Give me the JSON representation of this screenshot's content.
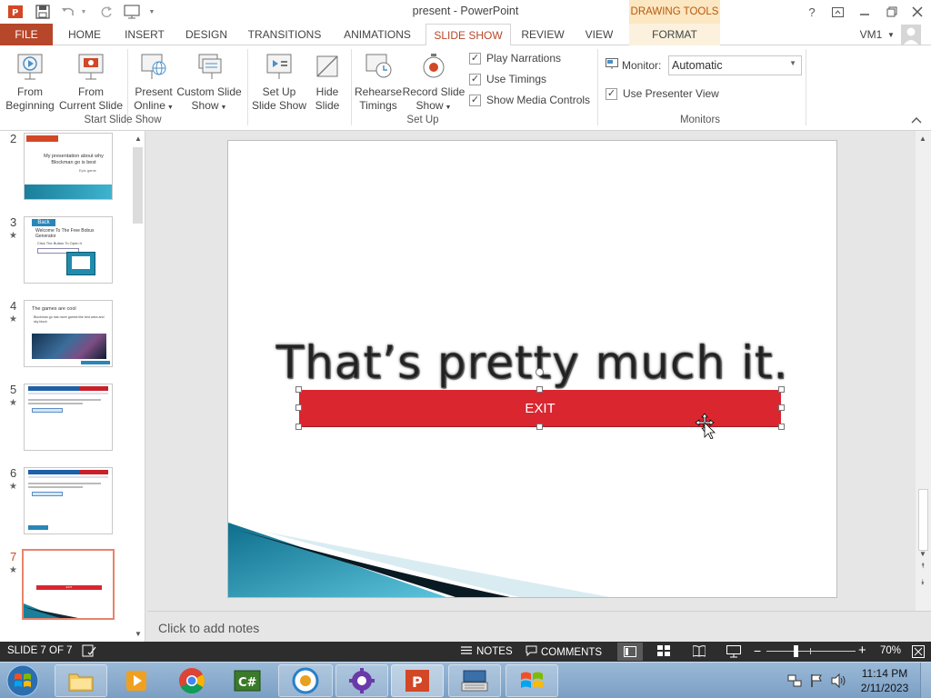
{
  "app": {
    "title": "present - PowerPoint",
    "contextual_tab_group": "DRAWING TOOLS",
    "user": "VM1",
    "help": "?"
  },
  "tabs": [
    {
      "label": "FILE"
    },
    {
      "label": "HOME"
    },
    {
      "label": "INSERT"
    },
    {
      "label": "DESIGN"
    },
    {
      "label": "TRANSITIONS"
    },
    {
      "label": "ANIMATIONS"
    },
    {
      "label": "SLIDE SHOW",
      "active": true
    },
    {
      "label": "REVIEW"
    },
    {
      "label": "VIEW"
    },
    {
      "label": "FORMAT"
    }
  ],
  "ribbon": {
    "start_group": {
      "label": "Start Slide Show",
      "from_beginning": [
        "From",
        "Beginning"
      ],
      "from_current": [
        "From",
        "Current Slide"
      ],
      "present_online": [
        "Present",
        "Online"
      ],
      "custom_show": [
        "Custom Slide",
        "Show"
      ]
    },
    "setup_group": {
      "label": "Set Up",
      "setup_show": [
        "Set Up",
        "Slide Show"
      ],
      "hide_slide": [
        "Hide",
        "Slide"
      ],
      "rehearse": [
        "Rehearse",
        "Timings"
      ],
      "record": [
        "Record Slide",
        "Show"
      ],
      "play_narrations": "Play Narrations",
      "use_timings": "Use Timings",
      "show_media_controls": "Show Media Controls"
    },
    "monitors_group": {
      "label": "Monitors",
      "monitor_label": "Monitor:",
      "monitor_value": "Automatic",
      "use_presenter_view": "Use Presenter View"
    }
  },
  "thumbnails": [
    {
      "num": "2",
      "star": false,
      "title": "My presentation about why Blockman go is best",
      "subtitle": "Epic game"
    },
    {
      "num": "3",
      "star": true,
      "tag": "Back",
      "title": "Welcome To The Free Bobux Generator",
      "body": "Click The Button To Open It"
    },
    {
      "num": "4",
      "star": true,
      "title": "The games are cool",
      "body": "Blockman go has more games like bed wars and sky block"
    },
    {
      "num": "5",
      "star": true
    },
    {
      "num": "6",
      "star": true
    },
    {
      "num": "7",
      "star": true,
      "selected": true,
      "button": "EXIT"
    }
  ],
  "slide": {
    "title": "That’s pretty much it.",
    "button_label": "EXIT"
  },
  "notes": {
    "placeholder": "Click to add notes"
  },
  "status": {
    "slide_indicator": "SLIDE 7 OF 7",
    "notes_label": "NOTES",
    "comments_label": "COMMENTS",
    "zoom": "70%"
  },
  "taskbar": {
    "time": "11:14 PM",
    "date": "2/11/2023"
  },
  "colors": {
    "accent": "#b7472a",
    "exit_button": "#d9262f",
    "contextual": "#fbe7c2"
  }
}
